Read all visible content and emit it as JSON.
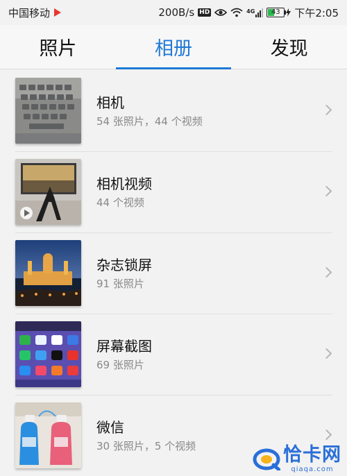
{
  "status_bar": {
    "carrier": "中国移动",
    "speed": "200B/s",
    "hd": "HD",
    "network": "4G",
    "battery": "43",
    "battery_level": 0.43,
    "time": "下午2:05"
  },
  "tabs": [
    {
      "label": "照片",
      "active": false
    },
    {
      "label": "相册",
      "active": true
    },
    {
      "label": "发现",
      "active": false
    }
  ],
  "albums": [
    {
      "name": "相机",
      "count": "54 张照片，44 个视频",
      "thumb": "keyboard"
    },
    {
      "name": "相机视频",
      "count": "44 个视频",
      "thumb": "video-yoga"
    },
    {
      "name": "杂志锁屏",
      "count": "91 张照片",
      "thumb": "cathedral-night"
    },
    {
      "name": "屏幕截图",
      "count": "69 张照片",
      "thumb": "phone-homescreen"
    },
    {
      "name": "微信",
      "count": "30 张照片，5 个视频",
      "thumb": "water-bottles"
    }
  ],
  "watermark": {
    "main": "恰卡网",
    "sub": "qiaqa.com"
  },
  "colors": {
    "accent": "#1f79d6",
    "battery": "#2db84d"
  }
}
